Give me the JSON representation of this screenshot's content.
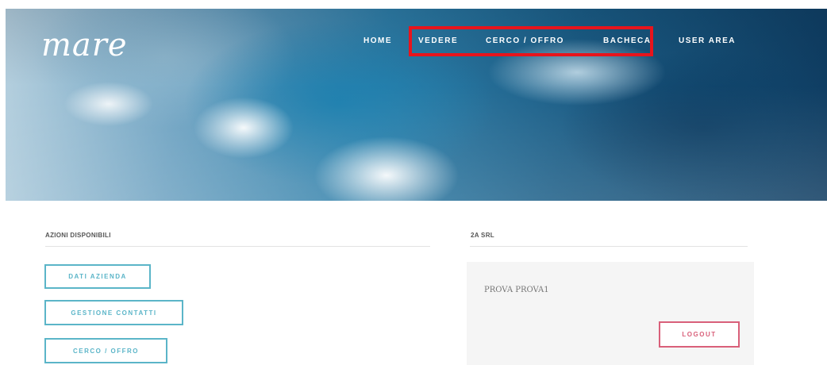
{
  "header": {
    "logo_text": "mare",
    "nav": [
      {
        "label": "HOME"
      },
      {
        "label": "VEDERE"
      },
      {
        "label": "CERCO / OFFRO"
      },
      {
        "label": "BACHECA"
      },
      {
        "label": "USER AREA"
      }
    ],
    "highlight_color": "#e8141c"
  },
  "actions": {
    "title": "AZIONI DISPONIBILI",
    "buttons": [
      {
        "label": "DATI AZIENDA"
      },
      {
        "label": "GESTIONE CONTATTI"
      },
      {
        "label": "CERCO / OFFRO"
      }
    ],
    "accent_color": "#5bb5c8"
  },
  "company": {
    "title": "2A SRL",
    "name": "PROVA PROVA1",
    "logout_label": "LOGOUT",
    "logout_color": "#d9607a"
  }
}
